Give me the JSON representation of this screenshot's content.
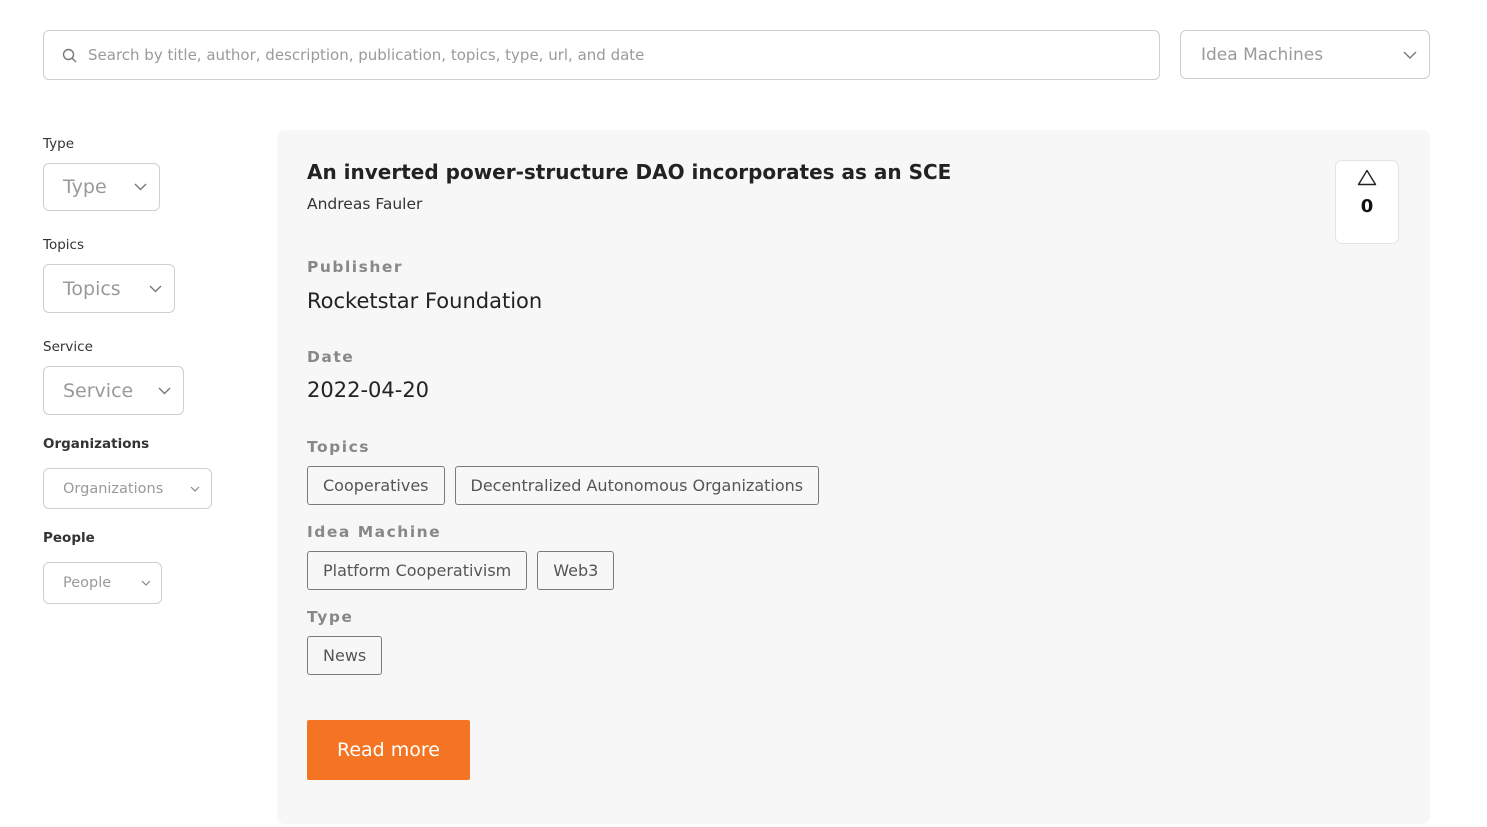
{
  "search": {
    "placeholder": "Search by title, author, description, publication, topics, type, url, and date"
  },
  "idea_machine_select": {
    "value": "Idea Machines"
  },
  "filters": {
    "type": {
      "label": "Type",
      "value": "Type"
    },
    "topics": {
      "label": "Topics",
      "value": "Topics"
    },
    "service": {
      "label": "Service",
      "value": "Service"
    },
    "organizations": {
      "label": "Organizations",
      "value": "Organizations"
    },
    "people": {
      "label": "People",
      "value": "People"
    }
  },
  "card": {
    "title": "An inverted power-structure DAO incorporates as an SCE",
    "author": "Andreas Fauler",
    "votes": "0",
    "publisher_label": "Publisher",
    "publisher": "Rocketstar Foundation",
    "date_label": "Date",
    "date": "2022-04-20",
    "topics_label": "Topics",
    "topics": [
      "Cooperatives",
      "Decentralized Autonomous Organizations"
    ],
    "idea_machine_label": "Idea Machine",
    "idea_machines": [
      "Platform Cooperativism",
      "Web3"
    ],
    "type_label": "Type",
    "types": [
      "News"
    ],
    "read_more": "Read more"
  },
  "colors": {
    "accent": "#f47424",
    "card_bg": "#f7f7f7",
    "border": "#cfcfcf"
  }
}
